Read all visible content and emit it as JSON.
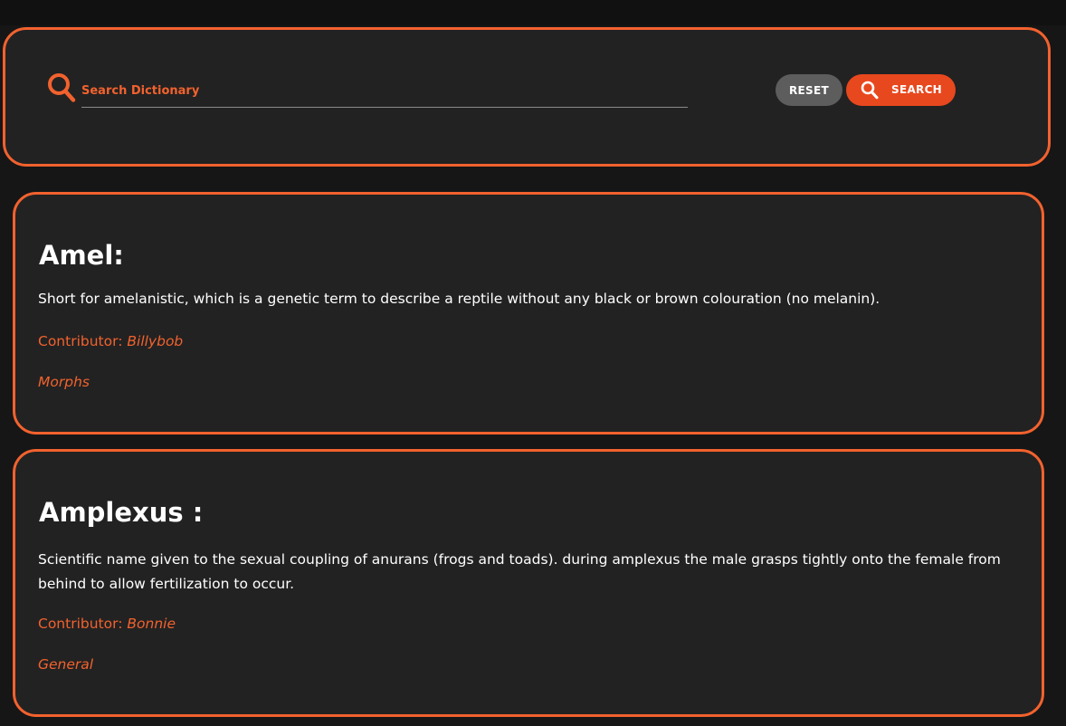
{
  "search": {
    "placeholder": "Search Dictionary",
    "value": "",
    "reset_label": "RESET",
    "search_label": "SEARCH",
    "icon": "search-icon",
    "accent_color": "#f2622e"
  },
  "entries": [
    {
      "term": "Amel:",
      "definition": "Short for amelanistic, which is a genetic term to describe a reptile without any black or brown colouration (no melanin).",
      "contributor_label": "Contributor:",
      "contributor_name": "Billybob",
      "category": "Morphs"
    },
    {
      "term": "Amplexus :",
      "definition": "Scientific name given to the sexual coupling of anurans (frogs and toads). during amplexus the male grasps tightly onto the female from behind to allow fertilization to occur.",
      "contributor_label": "Contributor:",
      "contributor_name": "Bonnie",
      "category": "General"
    }
  ]
}
